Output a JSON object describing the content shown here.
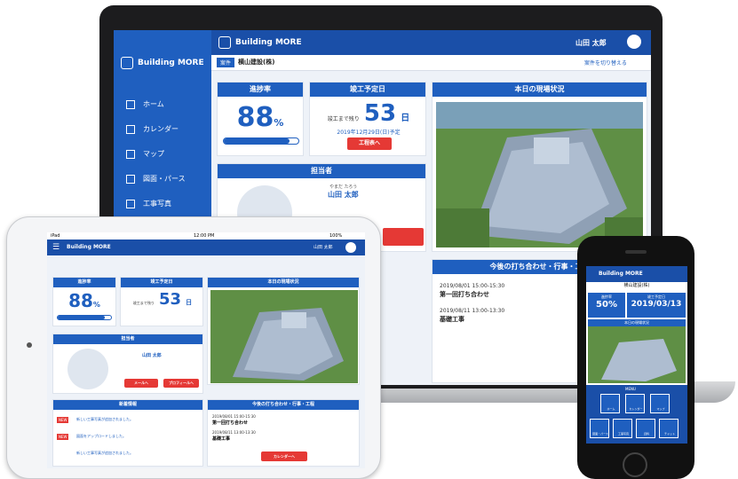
{
  "brand": "Building MORE",
  "user_name": "山田 太郎",
  "laptop": {
    "nav": [
      {
        "icon": "home-icon",
        "label": "ホーム"
      },
      {
        "icon": "calendar-icon",
        "label": "カレンダー"
      },
      {
        "icon": "map-icon",
        "label": "マップ"
      },
      {
        "icon": "blueprint-icon",
        "label": "図面・パース"
      },
      {
        "icon": "photo-icon",
        "label": "工事写真"
      }
    ],
    "project_tag": "案件",
    "project_name": "横山建設(株)",
    "project_link": "案件を切り替える",
    "progress_title": "進捗率",
    "progress_value": "88",
    "progress_unit": "%",
    "progress_fraction": 0.88,
    "completion_title": "竣工予定日",
    "completion_prefix": "竣工まで残り",
    "completion_days": "53",
    "completion_days_unit": "日",
    "completion_date": "2019年12月29日(日)予定",
    "completion_button": "工程表へ",
    "site_title": "本日の現場状況",
    "manager_title": "担当者",
    "manager_ruby": "やまだ たろう",
    "manager_name": "山田 太郎",
    "schedule_title": "今後の打ち合わせ・行事・工程",
    "schedule": [
      {
        "date": "2019/08/01 15:00-15:30",
        "title": "第一回打ち合わせ"
      },
      {
        "date": "2019/08/11 13:00-13:30",
        "title": "基礎工事"
      }
    ]
  },
  "tablet": {
    "status_left": "iPad",
    "status_time": "12:00 PM",
    "status_right": "100%",
    "progress_title": "進捗率",
    "progress_value": "88",
    "progress_unit": "%",
    "progress_fraction": 0.88,
    "completion_title": "竣工予定日",
    "completion_prefix": "竣工まで残り",
    "completion_days": "53",
    "completion_days_unit": "日",
    "site_title": "本日の現場状況",
    "manager_title": "担当者",
    "manager_name": "山田 太郎",
    "btn_left": "メールへ",
    "btn_right": "プロフィールへ",
    "news_title": "新着情報",
    "news": [
      {
        "tag": "NEW",
        "title": "新しい工事写真が追加されました。"
      },
      {
        "tag": "NEW",
        "title": "図面をアップロードしました。"
      },
      {
        "tag": "",
        "title": "新しい工事写真が追加されました。"
      }
    ],
    "schedule_title": "今後の打ち合わせ・行事・工程",
    "schedule": [
      {
        "date": "2019/08/01 15:00-15:30",
        "title": "第一回打ち合わせ"
      },
      {
        "date": "2019/08/11 13:00-13:30",
        "title": "基礎工事"
      }
    ],
    "calendar_button": "カレンダーへ"
  },
  "phone": {
    "project_name": "横山建設(株)",
    "progress_title": "進捗率",
    "progress_value": "50%",
    "completion_title": "竣工予定日",
    "completion_date": "2019/03/13",
    "site_title": "本日の現場状況",
    "menu_label": "MENU",
    "tiles": [
      {
        "icon": "home-icon",
        "label": "ホーム"
      },
      {
        "icon": "calendar-icon",
        "label": "カレンダー"
      },
      {
        "icon": "map-icon",
        "label": "マップ"
      },
      {
        "icon": "blueprint-icon",
        "label": "図面・パース"
      },
      {
        "icon": "photo-icon",
        "label": "工事写真"
      },
      {
        "icon": "document-icon",
        "label": "資料"
      },
      {
        "icon": "chat-icon",
        "label": "チャット"
      }
    ]
  },
  "colors": {
    "primary": "#1f5fbf",
    "dark": "#1a4fa8",
    "accent": "#e53935"
  }
}
